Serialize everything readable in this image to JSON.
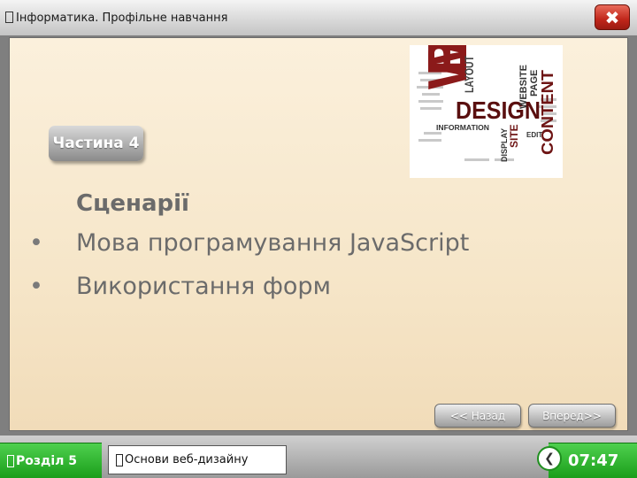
{
  "window": {
    "title": "Інформатика. Профільне навчання",
    "close_label": "✖"
  },
  "slide": {
    "part_label": "Частина 4",
    "heading": "Сценарії",
    "bullets": [
      "Мова програмування JavaScript",
      "Використання форм"
    ],
    "nav": {
      "back_label": "<< Назад",
      "next_label": "Вперед>>"
    }
  },
  "hero": {
    "icon": "web-design-word-cloud",
    "words": [
      "WEB",
      "DESIGN",
      "CONTENT",
      "LAYOUT",
      "WEBSITE",
      "PAGE",
      "INFORMATION",
      "DISPLAY",
      "SITE",
      "EDIT"
    ]
  },
  "bottom": {
    "section_label": "Розділ 5",
    "topic_label": "Основи веб-дизайну",
    "time": "07:47"
  },
  "colors": {
    "accent_green": "#22a622",
    "close_red": "#c0261a",
    "text_gray": "#6b6b6b",
    "word_red": "#8b1a1a"
  }
}
